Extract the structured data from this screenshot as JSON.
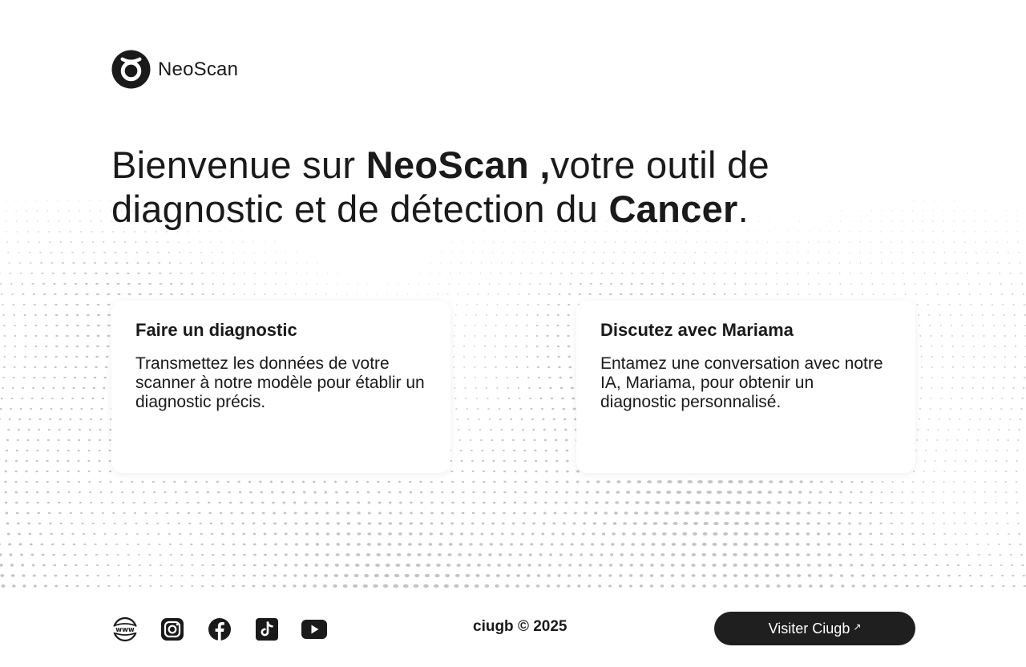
{
  "brand": {
    "name": "NeoScan"
  },
  "hero": {
    "part1": "Bienvenue sur ",
    "brand_bold": "NeoScan ,",
    "part2": "votre outil de diagnostic et de détection du ",
    "cancer_bold": "Cancer",
    "end": "."
  },
  "cards": [
    {
      "title": "Faire un diagnostic",
      "description": "Transmettez les données de votre scanner à notre modèle pour établir un diagnostic précis."
    },
    {
      "title": "Discutez avec Mariama",
      "description": "Entamez une conversation avec notre IA, Mariama, pour obtenir un diagnostic personnalisé."
    }
  ],
  "footer": {
    "socials": [
      "www-icon",
      "instagram-icon",
      "facebook-icon",
      "tiktok-icon",
      "youtube-icon"
    ],
    "copyright": "ciugb © 2025",
    "visit_label": "Visiter Ciugb",
    "visit_arrow": "↗"
  },
  "colors": {
    "text": "#1a1a1a",
    "button_bg": "#1f1f1f",
    "dots": "#c4c4c4"
  }
}
